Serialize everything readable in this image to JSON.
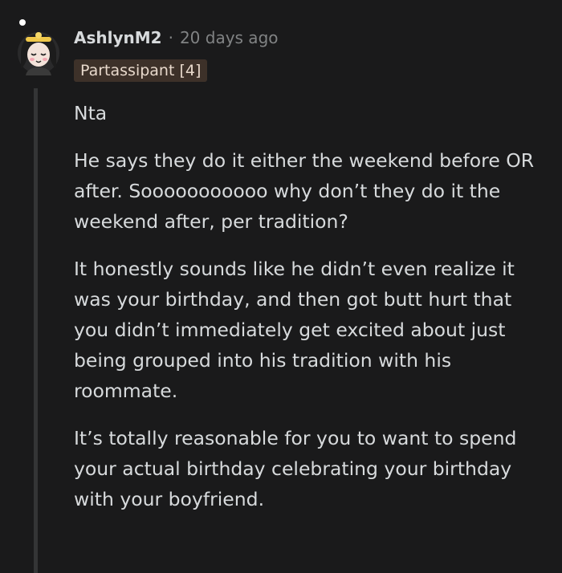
{
  "comment": {
    "author": "AshlynM2",
    "separator": "·",
    "timestamp": "20 days ago",
    "flair": "Partassipant [4]",
    "paragraphs": [
      "Nta",
      "He says they do it either the weekend before OR after. Sooooooooooo why don’t they do it the weekend after, per tradition?",
      "It honestly sounds like he didn’t even realize it was your birthday, and then got butt hurt that you didn’t immediately get excited about just being grouped into his tradition with his roommate.",
      "It’s totally reasonable for you to want to spend your actual birthday celebrating your birthday with your boyfriend."
    ]
  },
  "colors": {
    "background": "#1a1a1b",
    "text": "#d7dadc",
    "meta": "#818384",
    "flair_bg": "#3d3129",
    "thread_line": "#343536"
  },
  "icons": {
    "avatar": "user-avatar-icon"
  }
}
